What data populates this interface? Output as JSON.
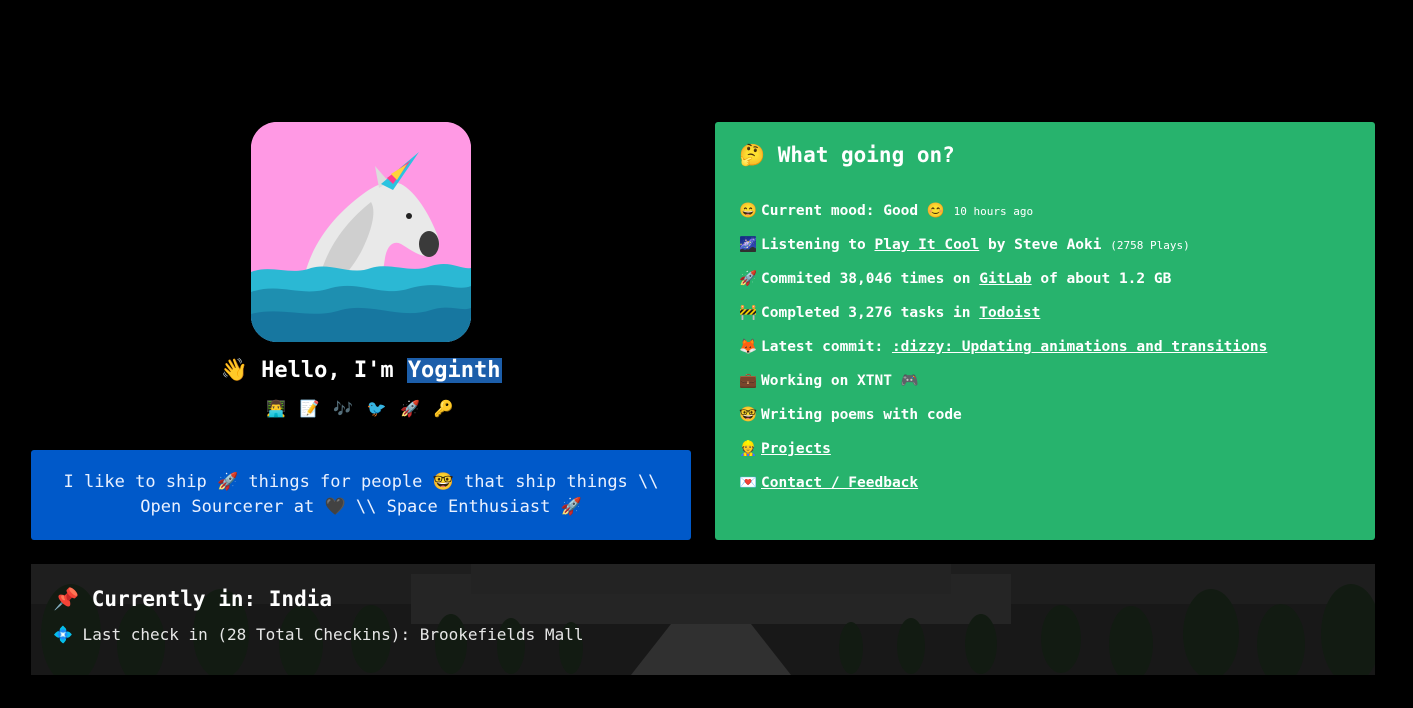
{
  "profile": {
    "hello_prefix": "👋 Hello, I'm ",
    "name": "Yoginth",
    "emoji_row": "👨‍💻 📝 🎶 🐦 🚀 🔑",
    "bio_line1": "I like to ship 🚀 things for people 🤓 that ship things \\\\",
    "bio_line2": "Open Sourcerer at 🖤 \\\\ Space Enthusiast 🚀",
    "avatar_bg": "#ff99e4"
  },
  "status": {
    "title": "🤔 What going on?",
    "bg_color": "#27b36d",
    "items": [
      {
        "icon": "😄",
        "pre": "Current mood: Good 😊 ",
        "small": "10 hours ago"
      },
      {
        "icon": "🌌",
        "pre": "Listening to ",
        "link": "Play It Cool",
        "post": " by Steve Aoki ",
        "small": "(2758 Plays)"
      },
      {
        "icon": "🚀",
        "pre": "Commited 38,046 times on ",
        "link": "GitLab",
        "post": " of about 1.2 GB"
      },
      {
        "icon": "🚧",
        "pre": "Completed 3,276 tasks in ",
        "link": "Todoist"
      },
      {
        "icon": "🦊",
        "pre": "Latest commit: ",
        "link": ":dizzy: Updating animations and transitions"
      },
      {
        "icon": "💼",
        "pre": "Working on XTNT 🎮"
      },
      {
        "icon": "🤓",
        "pre": "Writing poems with code"
      },
      {
        "icon": "👷",
        "link": "Projects"
      },
      {
        "icon": "💌",
        "link": "Contact / Feedback"
      }
    ]
  },
  "location": {
    "title": "📌 Currently in: India",
    "checkin": "💠 Last check in (28 Total Checkins): Brookefields Mall"
  },
  "colors": {
    "page_bg": "#000000",
    "bio_bg": "#0059c9",
    "name_highlight": "#1c5eaa"
  }
}
